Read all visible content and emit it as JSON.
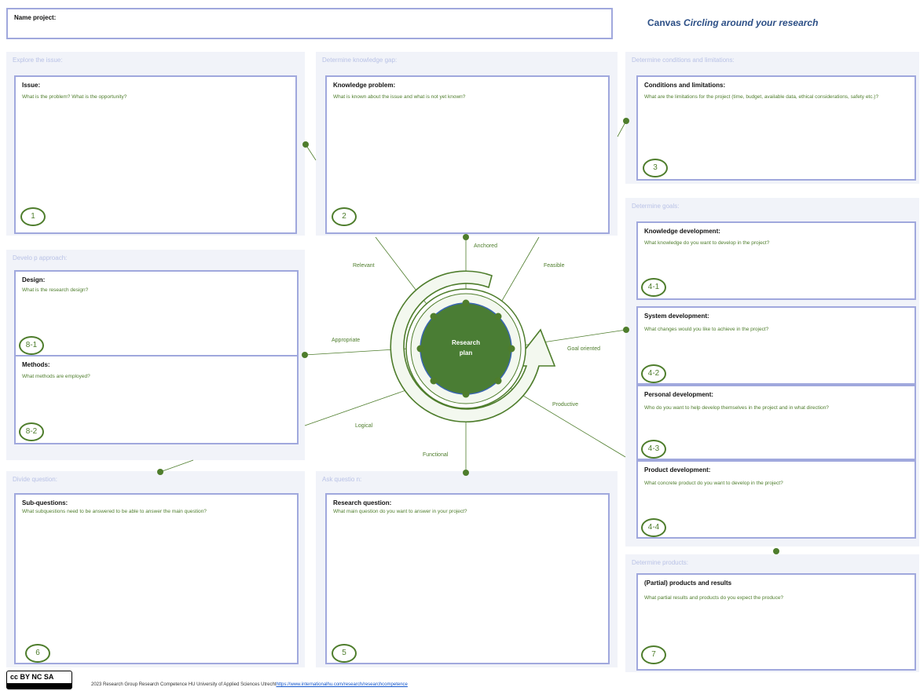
{
  "header": {
    "name_project_label": "Name project:",
    "canvas_title_prefix": "Canvas ",
    "canvas_title_italic": "Circling around your research"
  },
  "panels": {
    "explore": {
      "label": "Explore the issue:",
      "title": "Issue:",
      "question": "What is the problem? What is the opportunity?",
      "number": "1"
    },
    "knowledge_gap": {
      "label": "Determine knowledge gap:",
      "title": "Knowledge problem:",
      "question": "What is known about the issue and what is not yet known?",
      "number": "2"
    },
    "conditions": {
      "label": "Determine conditions and limitations:",
      "title": "Conditions and limitations:",
      "question": "What are the limitations for the project (time, budget, available data, ethical considerations, safety etc.)?",
      "number": "3"
    },
    "goals": {
      "label": "Determine goals:",
      "items": [
        {
          "title": "Knowledge development:",
          "question": "What knowledge do you want to develop in the project?",
          "number": "4-1"
        },
        {
          "title": "System development:",
          "question": "What changes would you like to achieve in the project?",
          "number": "4-2"
        },
        {
          "title": "Personal development:",
          "question": "Who do you want to help develop themselves in the project and in what direction?",
          "number": "4-3"
        },
        {
          "title": "Product development:",
          "question": "What concrete product do you want to develop in the project?",
          "number": "4-4"
        }
      ]
    },
    "approach": {
      "label": "Develo p approach:",
      "design": {
        "title": "Design:",
        "question": "What is the research design?",
        "number": "8-1"
      },
      "methods": {
        "title": "Methods:",
        "question": "What methods are employed?",
        "number": "8-2"
      }
    },
    "divide": {
      "label": "Divide question:",
      "title": "Sub-questions:",
      "question": "What subquestions need to be answered to be able to answer the main question?",
      "number": "6"
    },
    "ask": {
      "label": "Ask questio n:",
      "title": "Research question:",
      "question": "What main question do you want to answer in your project?",
      "number": "5"
    },
    "products": {
      "label": "Determine  products:",
      "title": "(Partial)  products and results",
      "question": "What partial results and products do you expect the produce?",
      "number": "7"
    }
  },
  "center": {
    "label_line1": "Research",
    "label_line2": "plan",
    "qualities": [
      "Anchored",
      "Feasible",
      "Goal oriented",
      "Productive",
      "Functional",
      "Logical",
      "Appropriate",
      "Relevant"
    ]
  },
  "footer": {
    "license_text": "cc BY NC SA",
    "credit": "2023 Research Group Research Competence HU University of Applied Sciences Utrecht",
    "link": "https://www.internationalhu.com/research/researchcompetence"
  },
  "colors": {
    "accent_green": "#4e7d2c",
    "box_border": "#a0a8dd",
    "panel_bg": "#f1f3f9",
    "center_fill": "#4a7d34"
  }
}
